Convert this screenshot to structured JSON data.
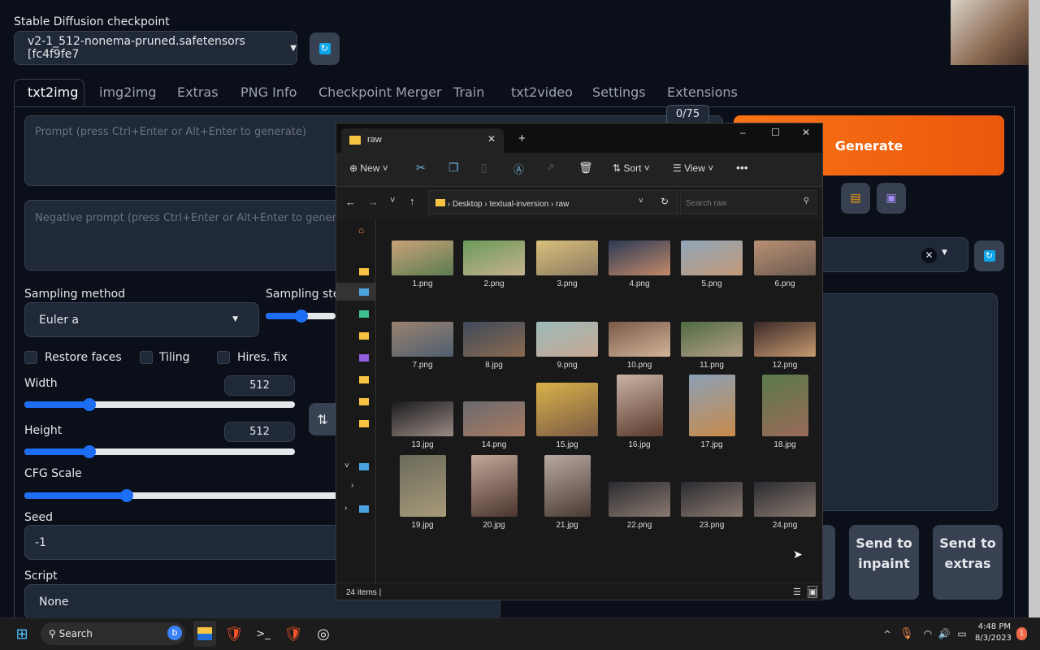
{
  "checkpoint": {
    "label": "Stable Diffusion checkpoint",
    "value": "v2-1_512-nonema-pruned.safetensors [fc4f9fe7"
  },
  "tabs": [
    "txt2img",
    "img2img",
    "Extras",
    "PNG Info",
    "Checkpoint Merger",
    "Train",
    "txt2video",
    "Settings",
    "Extensions"
  ],
  "prompt": {
    "placeholder": "Prompt (press Ctrl+Enter or Alt+Enter to generate)",
    "token_count": "0/75"
  },
  "negative_prompt": {
    "placeholder": "Negative prompt (press Ctrl+Enter or Alt+Enter to generate)"
  },
  "sampling": {
    "method_label": "Sampling method",
    "method": "Euler a",
    "steps_label": "Sampling steps",
    "steps_fraction": 0.2
  },
  "checkboxes": [
    {
      "label": "Restore faces",
      "checked": false
    },
    {
      "label": "Tiling",
      "checked": false
    },
    {
      "label": "Hires. fix",
      "checked": false
    }
  ],
  "width": {
    "label": "Width",
    "value": "512"
  },
  "height": {
    "label": "Height",
    "value": "512"
  },
  "cfg": {
    "label": "CFG Scale",
    "fraction": 0.33
  },
  "seed": {
    "label": "Seed",
    "value": "-1"
  },
  "script": {
    "label": "Script",
    "value": "None"
  },
  "generate_label": "Generate",
  "send_buttons": [
    {
      "label": "Send to inpaint"
    },
    {
      "label": "Send to extras"
    }
  ],
  "accent_color": "#f97316",
  "explorer": {
    "tab_title": "raw",
    "toolbar": {
      "new": "New",
      "sort": "Sort",
      "view": "View"
    },
    "breadcrumb": [
      "Desktop",
      "textual-inversion",
      "raw"
    ],
    "search_placeholder": "Search raw",
    "status": "24 items",
    "files": [
      "1.png",
      "2.png",
      "3.png",
      "4.png",
      "5.png",
      "6.png",
      "7.png",
      "8.jpg",
      "9.png",
      "10.png",
      "11.png",
      "12.png",
      "13.jpg",
      "14.png",
      "15.jpg",
      "16.jpg",
      "17.jpg",
      "18.jpg",
      "19.jpg",
      "20.jpg",
      "21.jpg",
      "22.png",
      "23.png",
      "24.png"
    ]
  },
  "taskbar": {
    "search": "Search",
    "time": "4:48 PM",
    "date": "8/3/2023",
    "notifications": "1"
  }
}
